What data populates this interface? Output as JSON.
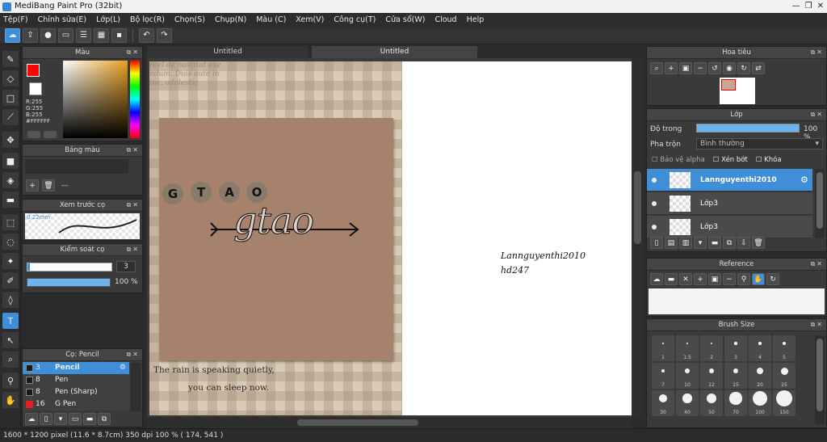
{
  "window": {
    "title": "MediBang Paint Pro (32bit)",
    "min": "—",
    "max": "❐",
    "close": "✕"
  },
  "menu": [
    "Tệp(F)",
    "Chỉnh sửa(E)",
    "Lớp(L)",
    "Bộ lọc(R)",
    "Chọn(S)",
    "Chụp(N)",
    "Màu (C)",
    "Xem(V)",
    "Công cụ(T)",
    "Cửa sổ(W)",
    "Cloud",
    "Help"
  ],
  "toolbar": {
    "icons": [
      "cloud-icon",
      "export-icon",
      "chat-icon",
      "note-icon",
      "page-icon",
      "grid-icon",
      "tiles-icon",
      "undo-icon",
      "redo-icon"
    ]
  },
  "color_panel": {
    "title": "Màu",
    "r": "R:255",
    "g": "G:255",
    "b": "B:255",
    "hex": "#FFFFFF",
    "fg": "#ff0000",
    "bg": "#ffffff"
  },
  "palette_panel": {
    "title": "Bảng màu",
    "empty": "---"
  },
  "preview_panel": {
    "title": "Xem trước cọ",
    "size": "0.22mm"
  },
  "control_panel": {
    "title": "Kiểm soát cọ",
    "size": "3",
    "opacity": "100 %",
    "opacity_value": 1.0
  },
  "brush_panel": {
    "title": "Cọ: Pencil",
    "brushes": [
      {
        "size": "3",
        "name": "Pencil",
        "color": "#1a1a1a",
        "selected": true
      },
      {
        "size": "8",
        "name": "Pen",
        "color": "#1a1a1a",
        "selected": false
      },
      {
        "size": "8",
        "name": "Pen (Sharp)",
        "color": "#1a1a1a",
        "selected": false
      },
      {
        "size": "16",
        "name": "G Pen",
        "color": "#e02020",
        "selected": false
      }
    ]
  },
  "tabs": [
    "Untitled",
    "Untitled"
  ],
  "canvas": {
    "letters": [
      "G",
      "T",
      "A",
      "O"
    ],
    "script": "gtao",
    "quote1": "The rain is speaking quietly,",
    "quote2": "you can sleep now.",
    "sig1": "Lannguyenthi2010",
    "sig2": "hd247",
    "bg_text": "réel de nostrud exe ndum. Duis aute in inc, adolestic"
  },
  "navigator": {
    "title": "Hoa tiêu"
  },
  "layer_panel": {
    "title": "Lớp",
    "opacity_label": "Độ trong",
    "opacity": "100 %",
    "opacity_value": 1.0,
    "blend_label": "Pha trộn",
    "blend": "Bình thường",
    "protect": "Bảo vệ alpha",
    "clip": "Xén bớt",
    "lock": "Khóa",
    "layers": [
      {
        "name": "Lannguyenthi2010",
        "selected": true
      },
      {
        "name": "Lớp3",
        "selected": false
      },
      {
        "name": "Lớp3",
        "selected": false
      }
    ]
  },
  "reference_panel": {
    "title": "Reference"
  },
  "brushsize_panel": {
    "title": "Brush Size",
    "sizes": [
      "1",
      "1.5",
      "2",
      "3",
      "4",
      "5",
      "7",
      "10",
      "12",
      "15",
      "20",
      "25",
      "30",
      "40",
      "50",
      "70",
      "100",
      "150"
    ]
  },
  "status": {
    "text": "1600 * 1200 pixel   (11.6 * 8.7cm)   350 dpi   100 %   ( 174, 541 )"
  }
}
